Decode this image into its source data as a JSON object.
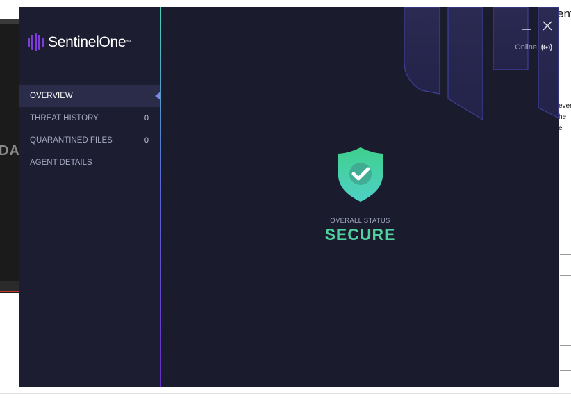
{
  "background": {
    "left_fragment": "DA",
    "right_title_fragment": "ent",
    "right_text_fragments": [
      "ever",
      "he",
      "e"
    ]
  },
  "app": {
    "brand": {
      "name": "SentinelOne",
      "trademark": "™",
      "color": "#7e3bdc"
    },
    "nav": [
      {
        "label": "OVERVIEW",
        "count": "",
        "active": true
      },
      {
        "label": "THREAT HISTORY",
        "count": "0",
        "active": false
      },
      {
        "label": "QUARANTINED FILES",
        "count": "0",
        "active": false
      },
      {
        "label": "AGENT DETAILS",
        "count": "",
        "active": false
      }
    ],
    "window_controls": {
      "minimize_icon": "minimize-icon",
      "close_icon": "close-icon"
    },
    "connection": {
      "label": "Online",
      "icon": "broadcast-icon"
    },
    "status": {
      "label": "OVERALL STATUS",
      "value": "SECURE",
      "icon": "shield-check-icon",
      "color": "#4fd1a0"
    }
  }
}
